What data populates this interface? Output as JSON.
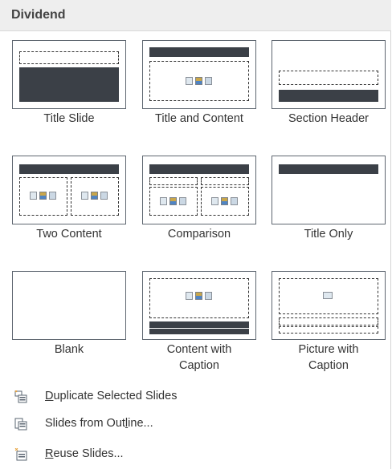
{
  "header": {
    "title": "Dividend"
  },
  "layouts": [
    {
      "name": "title-slide",
      "label": "Title Slide"
    },
    {
      "name": "title-and-content",
      "label": "Title and Content"
    },
    {
      "name": "section-header",
      "label": "Section Header"
    },
    {
      "name": "two-content",
      "label": "Two Content"
    },
    {
      "name": "comparison",
      "label": "Comparison"
    },
    {
      "name": "title-only",
      "label": "Title Only"
    },
    {
      "name": "blank",
      "label": "Blank"
    },
    {
      "name": "content-with-caption",
      "label_line1": "Content with",
      "label_line2": "Caption"
    },
    {
      "name": "picture-with-caption",
      "label_line1": "Picture with",
      "label_line2": "Caption"
    }
  ],
  "commands": [
    {
      "pre": "",
      "ul": "D",
      "post": "uplicate Selected Slides",
      "icon": "duplicate-slides-icon"
    },
    {
      "pre": "Slides from Out",
      "ul": "l",
      "post": "ine...",
      "icon": "slides-from-outline-icon"
    },
    {
      "pre": "",
      "ul": "R",
      "post": "euse Slides...",
      "icon": "reuse-slides-icon"
    }
  ],
  "colors": {
    "thumb_border": "#5e6670",
    "bar": "#3b4047",
    "header_bg": "#eeeeee"
  }
}
